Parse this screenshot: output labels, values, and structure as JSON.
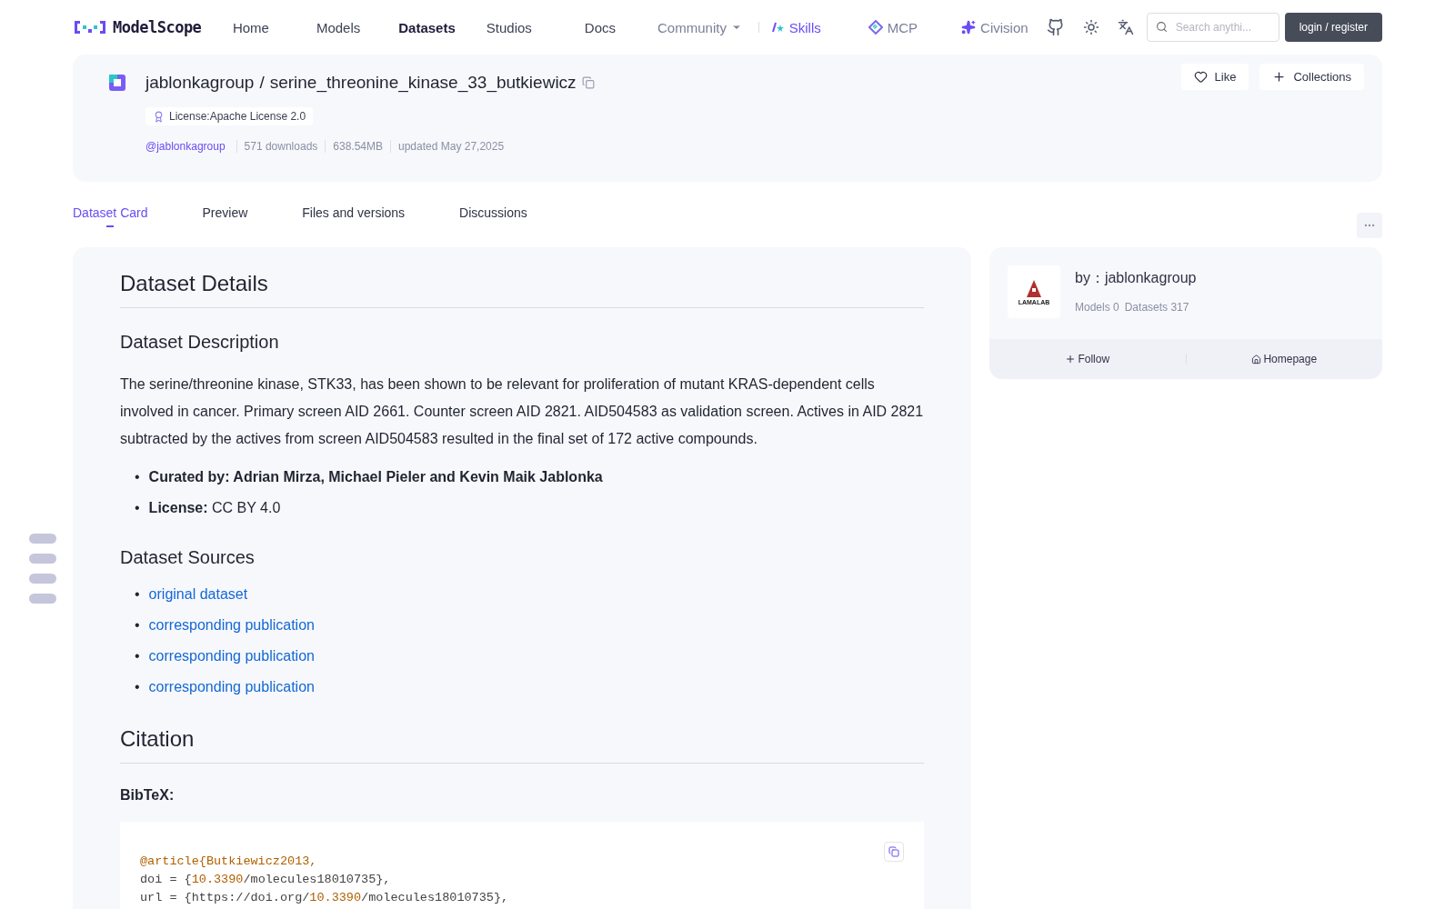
{
  "nav": {
    "logo": "ModelScope",
    "items": [
      {
        "label": "Home",
        "selected": false,
        "kind": "link"
      },
      {
        "label": "Models",
        "selected": false,
        "kind": "link"
      },
      {
        "label": "Datasets",
        "selected": true,
        "kind": "link"
      },
      {
        "label": "Studios",
        "selected": false,
        "kind": "link"
      },
      {
        "label": "Docs",
        "selected": false,
        "kind": "link"
      },
      {
        "label": "Community",
        "selected": false,
        "kind": "dropdown"
      },
      {
        "label": "Skills",
        "selected": false,
        "kind": "skills"
      },
      {
        "label": "MCP",
        "selected": false,
        "kind": "mcp"
      },
      {
        "label": "Civision",
        "selected": false,
        "kind": "civision"
      }
    ],
    "search": {
      "placeholder": "Search anythi..."
    },
    "login": "login / register"
  },
  "header": {
    "owner": "jablonkagroup",
    "separator": "/",
    "name": "serine_threonine_kinase_33_butkiewicz",
    "license": "License:Apache License 2.0",
    "author": "@jablonkagroup",
    "stats": [
      "571 downloads",
      "638.54MB",
      "updated May 27,2025"
    ],
    "like": "Like",
    "collections": "Collections"
  },
  "tabs": [
    {
      "label": "Dataset Card",
      "selected": true
    },
    {
      "label": "Preview",
      "selected": false
    },
    {
      "label": "Files and versions",
      "selected": false
    },
    {
      "label": "Discussions",
      "selected": false
    }
  ],
  "content": {
    "title": "Dataset Details",
    "description_heading": "Dataset Description",
    "description": "The serine/threonine kinase, STK33, has been shown to be relevant for proliferation of mutant KRAS-dependent cells involved in cancer. Primary screen AID 2661. Counter screen AID 2821. AID504583 as validation screen. Actives in AID 2821 subtracted by the actives from screen AID504583 resulted in the final set of 172 active compounds.",
    "bullet": "•",
    "facts": [
      "**Curated by: Adrian Mirza, Michael Pieler and Kevin Maik Jablonka**",
      "**License:** CC BY 4.0"
    ],
    "sources_heading": "Dataset Sources",
    "sources": [
      "original dataset",
      "corresponding publication",
      "corresponding publication",
      "corresponding publication"
    ],
    "citation_heading": "Citation",
    "bibtex_label": "BibTeX:",
    "code": [
      [
        {
          "kind": "key",
          "text": "@article{Butkiewicz2013,"
        }
      ],
      [
        {
          "kind": "plain",
          "text": "doi = {"
        },
        {
          "kind": "num",
          "text": "10.3390"
        },
        {
          "kind": "plain",
          "text": "/molecules18010735},"
        }
      ],
      [
        {
          "kind": "plain",
          "text": "url = {https://doi.org/"
        },
        {
          "kind": "num",
          "text": "10.3390"
        },
        {
          "kind": "plain",
          "text": "/molecules18010735},"
        }
      ]
    ]
  },
  "owner_card": {
    "by": "by：jablonkagroup",
    "logo_text": "LAMALAB",
    "stats": [
      "Models 0",
      "Datasets 317"
    ],
    "follow": "Follow",
    "homepage": "Homepage"
  }
}
